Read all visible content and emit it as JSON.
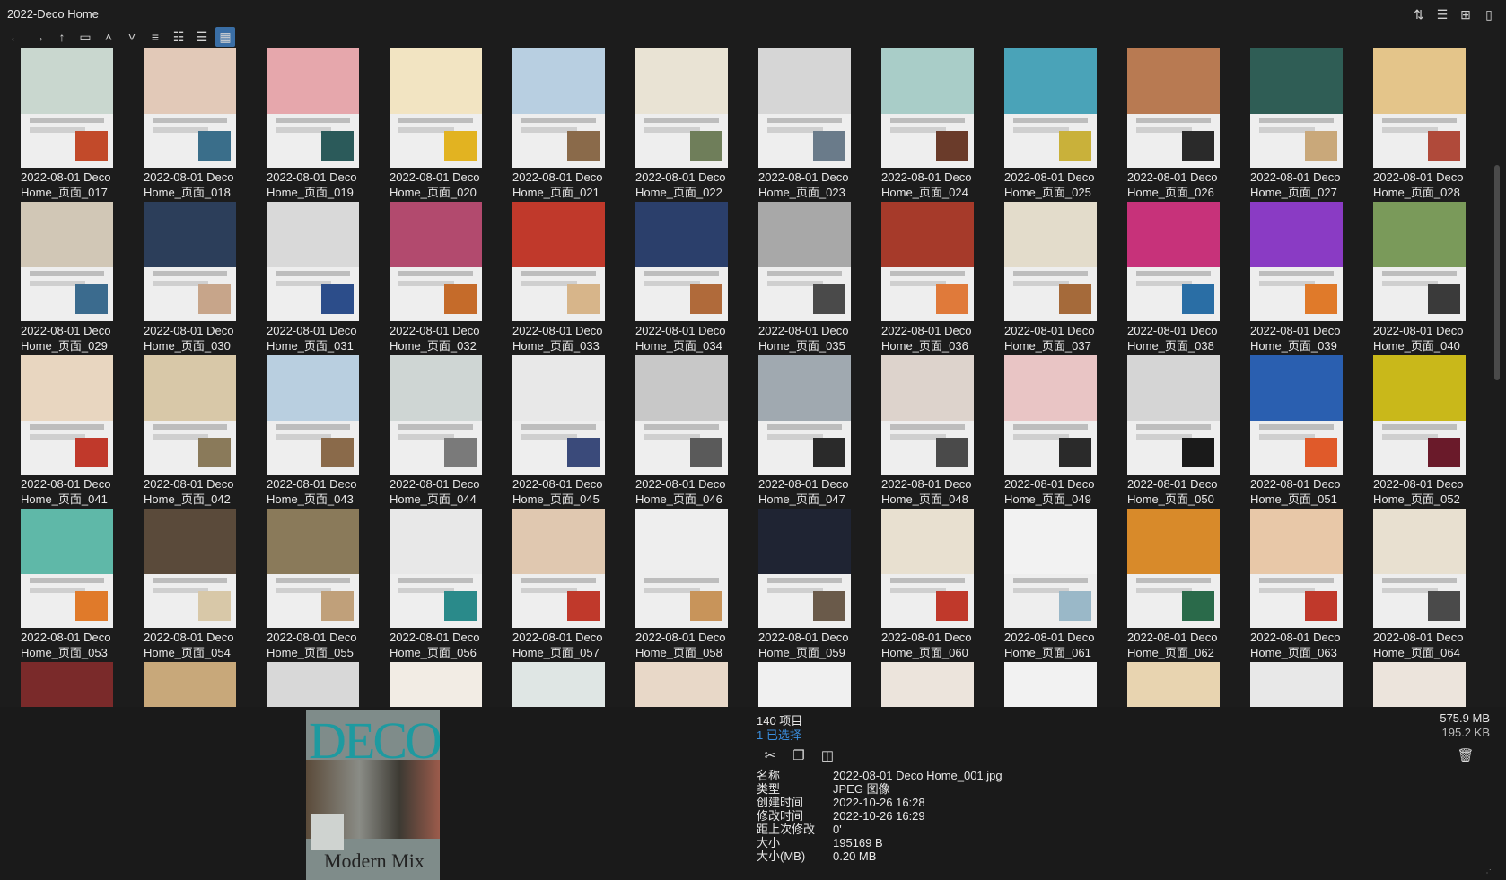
{
  "window": {
    "title": "2022-Deco Home"
  },
  "toolbar": {
    "nav": [
      "arrow-left-icon",
      "arrow-right-icon",
      "arrow-up-icon",
      "folder-icon",
      "chevron-up-icon",
      "chevron-down-icon"
    ],
    "views": [
      "list-view-icon",
      "details-view-icon",
      "tiles-view-icon",
      "thumbnails-view-icon"
    ],
    "active_view": "thumbnails-view-icon"
  },
  "header_right_icons": [
    "sort-icon",
    "list-icon",
    "new-window-icon",
    "clipboard-icon"
  ],
  "grid": {
    "items": [
      {
        "line1": "2022-08-01 Deco",
        "line2": "Home_页面_017",
        "c1": "#c9d7cf",
        "c2": "#c24a2a"
      },
      {
        "line1": "2022-08-01 Deco",
        "line2": "Home_页面_018",
        "c1": "#e2c9b8",
        "c2": "#3a6e8a"
      },
      {
        "line1": "2022-08-01 Deco",
        "line2": "Home_页面_019",
        "c1": "#e6a7ac",
        "c2": "#2b5a5a"
      },
      {
        "line1": "2022-08-01 Deco",
        "line2": "Home_页面_020",
        "c1": "#f2e4c2",
        "c2": "#e2b321"
      },
      {
        "line1": "2022-08-01 Deco",
        "line2": "Home_页面_021",
        "c1": "#b8cfe1",
        "c2": "#8a6a4a"
      },
      {
        "line1": "2022-08-01 Deco",
        "line2": "Home_页面_022",
        "c1": "#e9e3d4",
        "c2": "#6f7e5a"
      },
      {
        "line1": "2022-08-01 Deco",
        "line2": "Home_页面_023",
        "c1": "#d6d6d6",
        "c2": "#6a7b8a"
      },
      {
        "line1": "2022-08-01 Deco",
        "line2": "Home_页面_024",
        "c1": "#a9cdc8",
        "c2": "#6a3b2a"
      },
      {
        "line1": "2022-08-01 Deco",
        "line2": "Home_页面_025",
        "c1": "#4aa3b8",
        "c2": "#c9b13a"
      },
      {
        "line1": "2022-08-01 Deco",
        "line2": "Home_页面_026",
        "c1": "#b87a52",
        "c2": "#2a2a2a"
      },
      {
        "line1": "2022-08-01 Deco",
        "line2": "Home_页面_027",
        "c1": "#2f5d55",
        "c2": "#c9a87a"
      },
      {
        "line1": "2022-08-01 Deco",
        "line2": "Home_页面_028",
        "c1": "#e4c58a",
        "c2": "#b04a3a"
      },
      {
        "line1": "2022-08-01 Deco",
        "line2": "Home_页面_029",
        "c1": "#d1c7b6",
        "c2": "#3b6b8e"
      },
      {
        "line1": "2022-08-01 Deco",
        "line2": "Home_页面_030",
        "c1": "#2c3e5a",
        "c2": "#c7a58a"
      },
      {
        "line1": "2022-08-01 Deco",
        "line2": "Home_页面_031",
        "c1": "#d9d9d9",
        "c2": "#2c4d8a"
      },
      {
        "line1": "2022-08-01 Deco",
        "line2": "Home_页面_032",
        "c1": "#b24a6e",
        "c2": "#c56b2a"
      },
      {
        "line1": "2022-08-01 Deco",
        "line2": "Home_页面_033",
        "c1": "#c0392b",
        "c2": "#d7b58a"
      },
      {
        "line1": "2022-08-01 Deco",
        "line2": "Home_页面_034",
        "c1": "#2b3f6b",
        "c2": "#b06a3a"
      },
      {
        "line1": "2022-08-01 Deco",
        "line2": "Home_页面_035",
        "c1": "#a8a8a8",
        "c2": "#4a4a4a"
      },
      {
        "line1": "2022-08-01 Deco",
        "line2": "Home_页面_036",
        "c1": "#a63a2a",
        "c2": "#e07a3a"
      },
      {
        "line1": "2022-08-01 Deco",
        "line2": "Home_页面_037",
        "c1": "#e3dccb",
        "c2": "#a56a3a"
      },
      {
        "line1": "2022-08-01 Deco",
        "line2": "Home_页面_038",
        "c1": "#c7327a",
        "c2": "#2a6ea5"
      },
      {
        "line1": "2022-08-01 Deco",
        "line2": "Home_页面_039",
        "c1": "#8a3bc4",
        "c2": "#e07a2a"
      },
      {
        "line1": "2022-08-01 Deco",
        "line2": "Home_页面_040",
        "c1": "#7a9a5a",
        "c2": "#3a3a3a"
      },
      {
        "line1": "2022-08-01 Deco",
        "line2": "Home_页面_041",
        "c1": "#e8d6c0",
        "c2": "#c0392b"
      },
      {
        "line1": "2022-08-01 Deco",
        "line2": "Home_页面_042",
        "c1": "#d8c8a8",
        "c2": "#8a7a5a"
      },
      {
        "line1": "2022-08-01 Deco",
        "line2": "Home_页面_043",
        "c1": "#b9cfe0",
        "c2": "#8a6a4a"
      },
      {
        "line1": "2022-08-01 Deco",
        "line2": "Home_页面_044",
        "c1": "#cfd6d4",
        "c2": "#7a7a7a"
      },
      {
        "line1": "2022-08-01 Deco",
        "line2": "Home_页面_045",
        "c1": "#e8e8e8",
        "c2": "#3a4a7a"
      },
      {
        "line1": "2022-08-01 Deco",
        "line2": "Home_页面_046",
        "c1": "#c8c8c8",
        "c2": "#5a5a5a"
      },
      {
        "line1": "2022-08-01 Deco",
        "line2": "Home_页面_047",
        "c1": "#a0a9b0",
        "c2": "#2a2a2a"
      },
      {
        "line1": "2022-08-01 Deco",
        "line2": "Home_页面_048",
        "c1": "#ddd3cc",
        "c2": "#4a4a4a"
      },
      {
        "line1": "2022-08-01 Deco",
        "line2": "Home_页面_049",
        "c1": "#e9c5c5",
        "c2": "#2a2a2a"
      },
      {
        "line1": "2022-08-01 Deco",
        "line2": "Home_页面_050",
        "c1": "#d5d5d5",
        "c2": "#1a1a1a"
      },
      {
        "line1": "2022-08-01 Deco",
        "line2": "Home_页面_051",
        "c1": "#2a5fb0",
        "c2": "#e05a2a"
      },
      {
        "line1": "2022-08-01 Deco",
        "line2": "Home_页面_052",
        "c1": "#c9b81a",
        "c2": "#6a1a2a"
      },
      {
        "line1": "2022-08-01 Deco",
        "line2": "Home_页面_053",
        "c1": "#5fb8a8",
        "c2": "#e07a2a"
      },
      {
        "line1": "2022-08-01 Deco",
        "line2": "Home_页面_054",
        "c1": "#5a4a3a",
        "c2": "#d8c8a8"
      },
      {
        "line1": "2022-08-01 Deco",
        "line2": "Home_页面_055",
        "c1": "#8a7a5a",
        "c2": "#c0a07a"
      },
      {
        "line1": "2022-08-01 Deco",
        "line2": "Home_页面_056",
        "c1": "#e8e8e8",
        "c2": "#2a8a8a"
      },
      {
        "line1": "2022-08-01 Deco",
        "line2": "Home_页面_057",
        "c1": "#e0c8b0",
        "c2": "#c0392b"
      },
      {
        "line1": "2022-08-01 Deco",
        "line2": "Home_页面_058",
        "c1": "#eeeeee",
        "c2": "#c8945a"
      },
      {
        "line1": "2022-08-01 Deco",
        "line2": "Home_页面_059",
        "c1": "#1f2433",
        "c2": "#6a5a4a"
      },
      {
        "line1": "2022-08-01 Deco",
        "line2": "Home_页面_060",
        "c1": "#e8e0d0",
        "c2": "#c0392b"
      },
      {
        "line1": "2022-08-01 Deco",
        "line2": "Home_页面_061",
        "c1": "#f2f2f2",
        "c2": "#9ab8c8"
      },
      {
        "line1": "2022-08-01 Deco",
        "line2": "Home_页面_062",
        "c1": "#d88a2a",
        "c2": "#2a6a4a"
      },
      {
        "line1": "2022-08-01 Deco",
        "line2": "Home_页面_063",
        "c1": "#e8c8a8",
        "c2": "#c0392b"
      },
      {
        "line1": "2022-08-01 Deco",
        "line2": "Home_页面_064",
        "c1": "#e8e0d0",
        "c2": "#4a4a4a"
      },
      {
        "line1": "",
        "line2": "",
        "c1": "#7a2a2a",
        "c2": "#3a3a3a"
      },
      {
        "line1": "",
        "line2": "",
        "c1": "#c8a87a",
        "c2": "#2a5a8a"
      },
      {
        "line1": "",
        "line2": "",
        "c1": "#d8d8d8",
        "c2": "#3a3a3a"
      },
      {
        "line1": "",
        "line2": "",
        "c1": "#f2ece4",
        "c2": "#c0392b"
      },
      {
        "line1": "",
        "line2": "",
        "c1": "#dfe6e4",
        "c2": "#8aa0a0"
      },
      {
        "line1": "",
        "line2": "",
        "c1": "#e8d8c8",
        "c2": "#6a4a3a"
      },
      {
        "line1": "",
        "line2": "",
        "c1": "#f0f0f0",
        "c2": "#a8a8a8"
      },
      {
        "line1": "",
        "line2": "",
        "c1": "#ece4dc",
        "c2": "#c8b8a8"
      },
      {
        "line1": "",
        "line2": "",
        "c1": "#f2f2f2",
        "c2": "#d8d8d8"
      },
      {
        "line1": "",
        "line2": "",
        "c1": "#e8d4b0",
        "c2": "#c8945a"
      },
      {
        "line1": "",
        "line2": "",
        "c1": "#e8e8e8",
        "c2": "#4a4a4a"
      },
      {
        "line1": "",
        "line2": "",
        "c1": "#ece4dc",
        "c2": "#2a2a2a"
      }
    ]
  },
  "status": {
    "count": "140 项目",
    "selected": "1 已选择",
    "size_total": "575.9 MB",
    "size_selected": "195.2 KB"
  },
  "preview": {
    "masthead": "DECO",
    "cover_line": "Modern Mix"
  },
  "actions": [
    "cut-icon",
    "copy-icon",
    "compare-icon"
  ],
  "properties": [
    {
      "k": "名称",
      "v": "2022-08-01 Deco Home_001.jpg"
    },
    {
      "k": "类型",
      "v": "JPEG 图像"
    },
    {
      "k": "创建时间",
      "v": "2022-10-26  16:28"
    },
    {
      "k": "修改时间",
      "v": "2022-10-26  16:29"
    },
    {
      "k": "距上次修改",
      "v": "0'"
    },
    {
      "k": "大小",
      "v": "195169 B"
    },
    {
      "k": "大小(MB)",
      "v": "0.20 MB"
    }
  ]
}
